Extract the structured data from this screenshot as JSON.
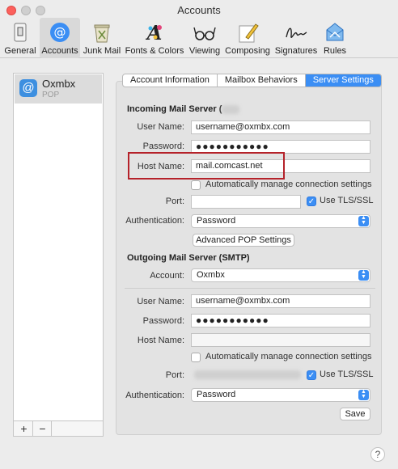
{
  "window": {
    "title": "Accounts"
  },
  "toolbar": {
    "items": [
      {
        "label": "General",
        "icon": "general-switch-icon"
      },
      {
        "label": "Accounts",
        "icon": "at-sign-icon",
        "active": true
      },
      {
        "label": "Junk Mail",
        "icon": "junk-mail-icon"
      },
      {
        "label": "Fonts & Colors",
        "icon": "fonts-colors-icon"
      },
      {
        "label": "Viewing",
        "icon": "glasses-icon"
      },
      {
        "label": "Composing",
        "icon": "pencil-paper-icon"
      },
      {
        "label": "Signatures",
        "icon": "signature-icon"
      },
      {
        "label": "Rules",
        "icon": "rules-envelope-icon"
      }
    ]
  },
  "sidebar": {
    "account": {
      "name": "Oxmbx",
      "type": "POP"
    },
    "add_label": "+",
    "remove_label": "−"
  },
  "tabs": [
    {
      "label": "Account Information"
    },
    {
      "label": "Mailbox Behaviors"
    },
    {
      "label": "Server Settings",
      "active": true
    }
  ],
  "incoming": {
    "title": "Incoming Mail Server (",
    "username_label": "User Name:",
    "username_value": "username@oxmbx.com",
    "password_label": "Password:",
    "password_value": "●●●●●●●●●●●",
    "host_label": "Host Name:",
    "host_value": "mail.comcast.net",
    "auto_manage_label": "Automatically manage connection settings",
    "port_label": "Port:",
    "port_value": "",
    "tls_label": "Use TLS/SSL",
    "auth_label": "Authentication:",
    "auth_value": "Password",
    "advanced_button": "Advanced POP Settings"
  },
  "outgoing": {
    "title": "Outgoing Mail Server (SMTP)",
    "account_label": "Account:",
    "account_value": "Oxmbx",
    "username_label": "User Name:",
    "username_value": "username@oxmbx.com",
    "password_label": "Password:",
    "password_value": "●●●●●●●●●●●",
    "host_label": "Host Name:",
    "host_value": "",
    "auto_manage_label": "Automatically manage connection settings",
    "port_label": "Port:",
    "tls_label": "Use TLS/SSL",
    "auth_label": "Authentication:",
    "auth_value": "Password",
    "save_button": "Save"
  },
  "help": {
    "label": "?"
  },
  "colors": {
    "accent": "#3b8ef4",
    "highlight": "#b5222a"
  }
}
